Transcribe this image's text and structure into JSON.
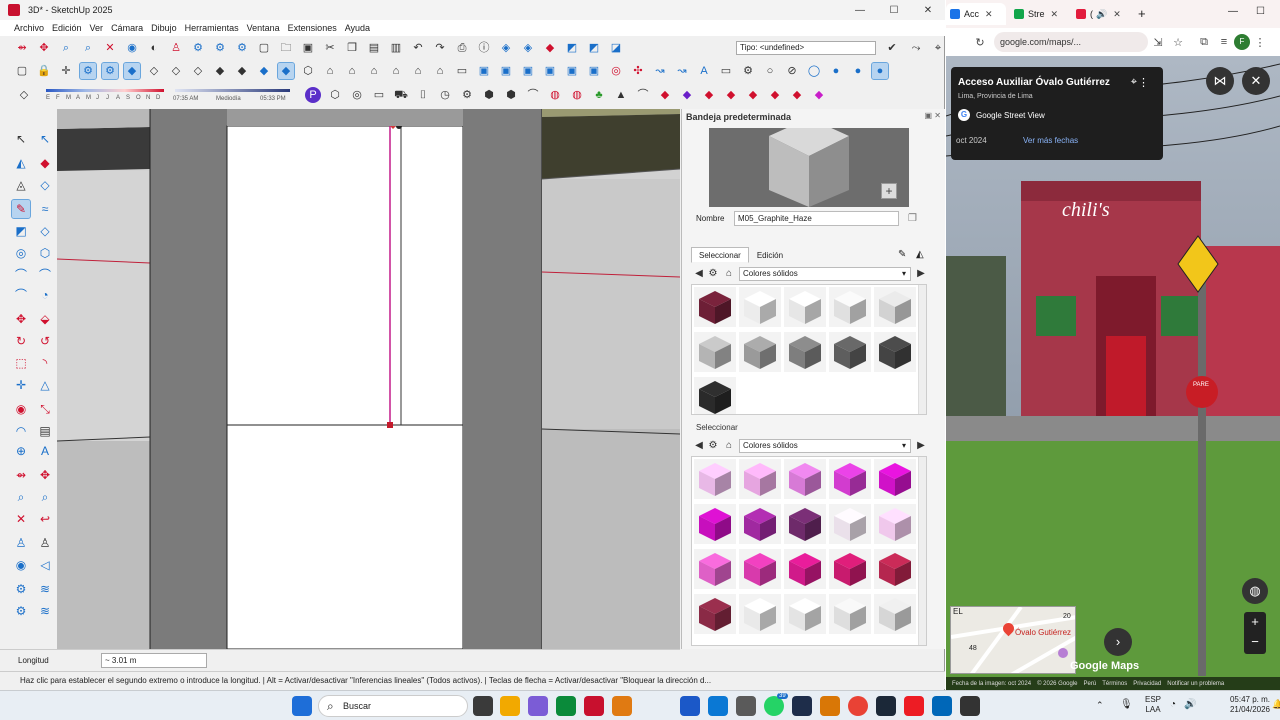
{
  "sketchup": {
    "window_title": "3D* - SketchUp 2025",
    "menus": [
      "Archivo",
      "Edición",
      "Ver",
      "Cámara",
      "Dibujo",
      "Herramientas",
      "Ventana",
      "Extensiones",
      "Ayuda"
    ],
    "tipo_field": "Tipo: <undefined>",
    "month_letters": [
      "E",
      "F",
      "M",
      "A",
      "M",
      "J",
      "J",
      "A",
      "S",
      "O",
      "N",
      "D"
    ],
    "time_start": "07:35 AM",
    "time_mid": "Mediodía",
    "time_end": "05:33 PM",
    "tray": {
      "title": "Bandeja predeterminada",
      "name_label": "Nombre",
      "material_name": "M05_Graphite_Haze",
      "tab_select": "Seleccionar",
      "tab_edit": "Edición",
      "library": "Colores sólidos",
      "section2_title": "Seleccionar",
      "library2": "Colores sólidos",
      "swatches1": [
        "#6d1f36",
        "#ececec",
        "#e6e6e6",
        "#e0e0e0",
        "#d2d2d2",
        "#b4b4b4",
        "#9a9a9a",
        "#7e7e7e",
        "#5e5e5e",
        "#444444",
        "#2a2a2a"
      ],
      "swatches2": [
        "#e8b8e6",
        "#e6a5e0",
        "#d77ad6",
        "#d23ccf",
        "#d012c8",
        "#c70fbd",
        "#a029a0",
        "#6e2a6a",
        "#eae0ea",
        "#f0c8ec",
        "#de60c6",
        "#d83aac",
        "#d01a8a",
        "#c81b6e",
        "#b5264f",
        "#8a2a46",
        "#e9e9e9",
        "#e4e4e4",
        "#dedede",
        "#d6d6d6"
      ]
    },
    "measure_label": "Longitud",
    "measure_value": "~ 3.01 m",
    "status_text": "Haz clic para establecer el segundo extremo o introduce la longitud. | Alt = Activar/desactivar \"Inferencias lineales\" (Todos activos). | Teclas de flecha = Activar/desactivar \"Bloquear la dirección d..."
  },
  "chrome": {
    "tabs": [
      {
        "label": "Acc",
        "color": "#1a73e8"
      },
      {
        "label": "Stre",
        "color": "#11a54a"
      },
      {
        "label": "(",
        "color": "#e21b3c"
      }
    ],
    "url": "google.com/maps/...",
    "place_title": "Acceso Auxiliar Óvalo Gutiérrez",
    "place_subtitle": "Lima, Provincia de Lima",
    "source": "Google Street View",
    "date": "oct 2024",
    "more_dates": "Ver más fechas",
    "map_label": "Óvalo Gutiérrez",
    "map_el": "EL",
    "map_num1": "20",
    "map_num2": "48",
    "brand_word": "Google Maps",
    "sign_text": "PARE",
    "store_text": "chili's",
    "footer": [
      "Fecha de la imagen: oct 2024",
      "© 2026 Google",
      "Perú",
      "Términos",
      "Privacidad",
      "Notificar un problema"
    ]
  },
  "taskbar": {
    "search": "Buscar",
    "badge": "39",
    "lang1": "ESP",
    "lang2": "LAA",
    "time": "05:47 p. m.",
    "date": "21/04/2026"
  }
}
